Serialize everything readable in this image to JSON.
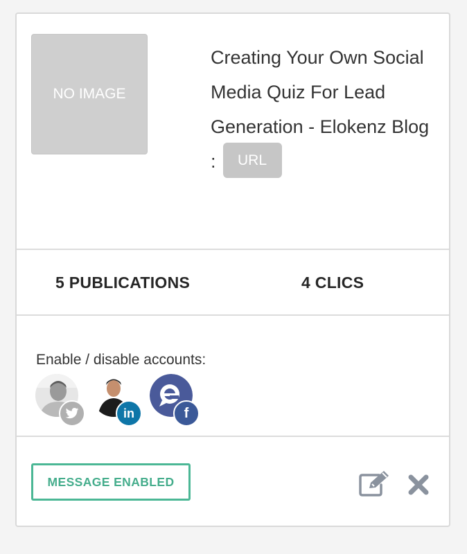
{
  "post": {
    "thumbnail_text": "NO IMAGE",
    "title": "Creating Your Own Social Media Quiz For Lead Generation - Elokenz Blog :",
    "url_label": "URL"
  },
  "stats": {
    "publications": "5 PUBLICATIONS",
    "clicks": "4 CLICS"
  },
  "accounts": {
    "label": "Enable / disable accounts:",
    "items": [
      {
        "network": "twitter",
        "badge_icon": "twitter-icon",
        "badge_color": "#b0b0b0"
      },
      {
        "network": "linkedin",
        "badge_icon": "linkedin-icon",
        "badge_text": "in",
        "badge_color": "#0e76a8"
      },
      {
        "network": "facebook",
        "badge_icon": "facebook-icon",
        "badge_text": "f",
        "badge_color": "#3b5998"
      }
    ]
  },
  "footer": {
    "status_label": "MESSAGE ENABLED",
    "status_color": "#4bb795",
    "edit_icon": "edit-icon",
    "delete_icon": "close-icon"
  }
}
